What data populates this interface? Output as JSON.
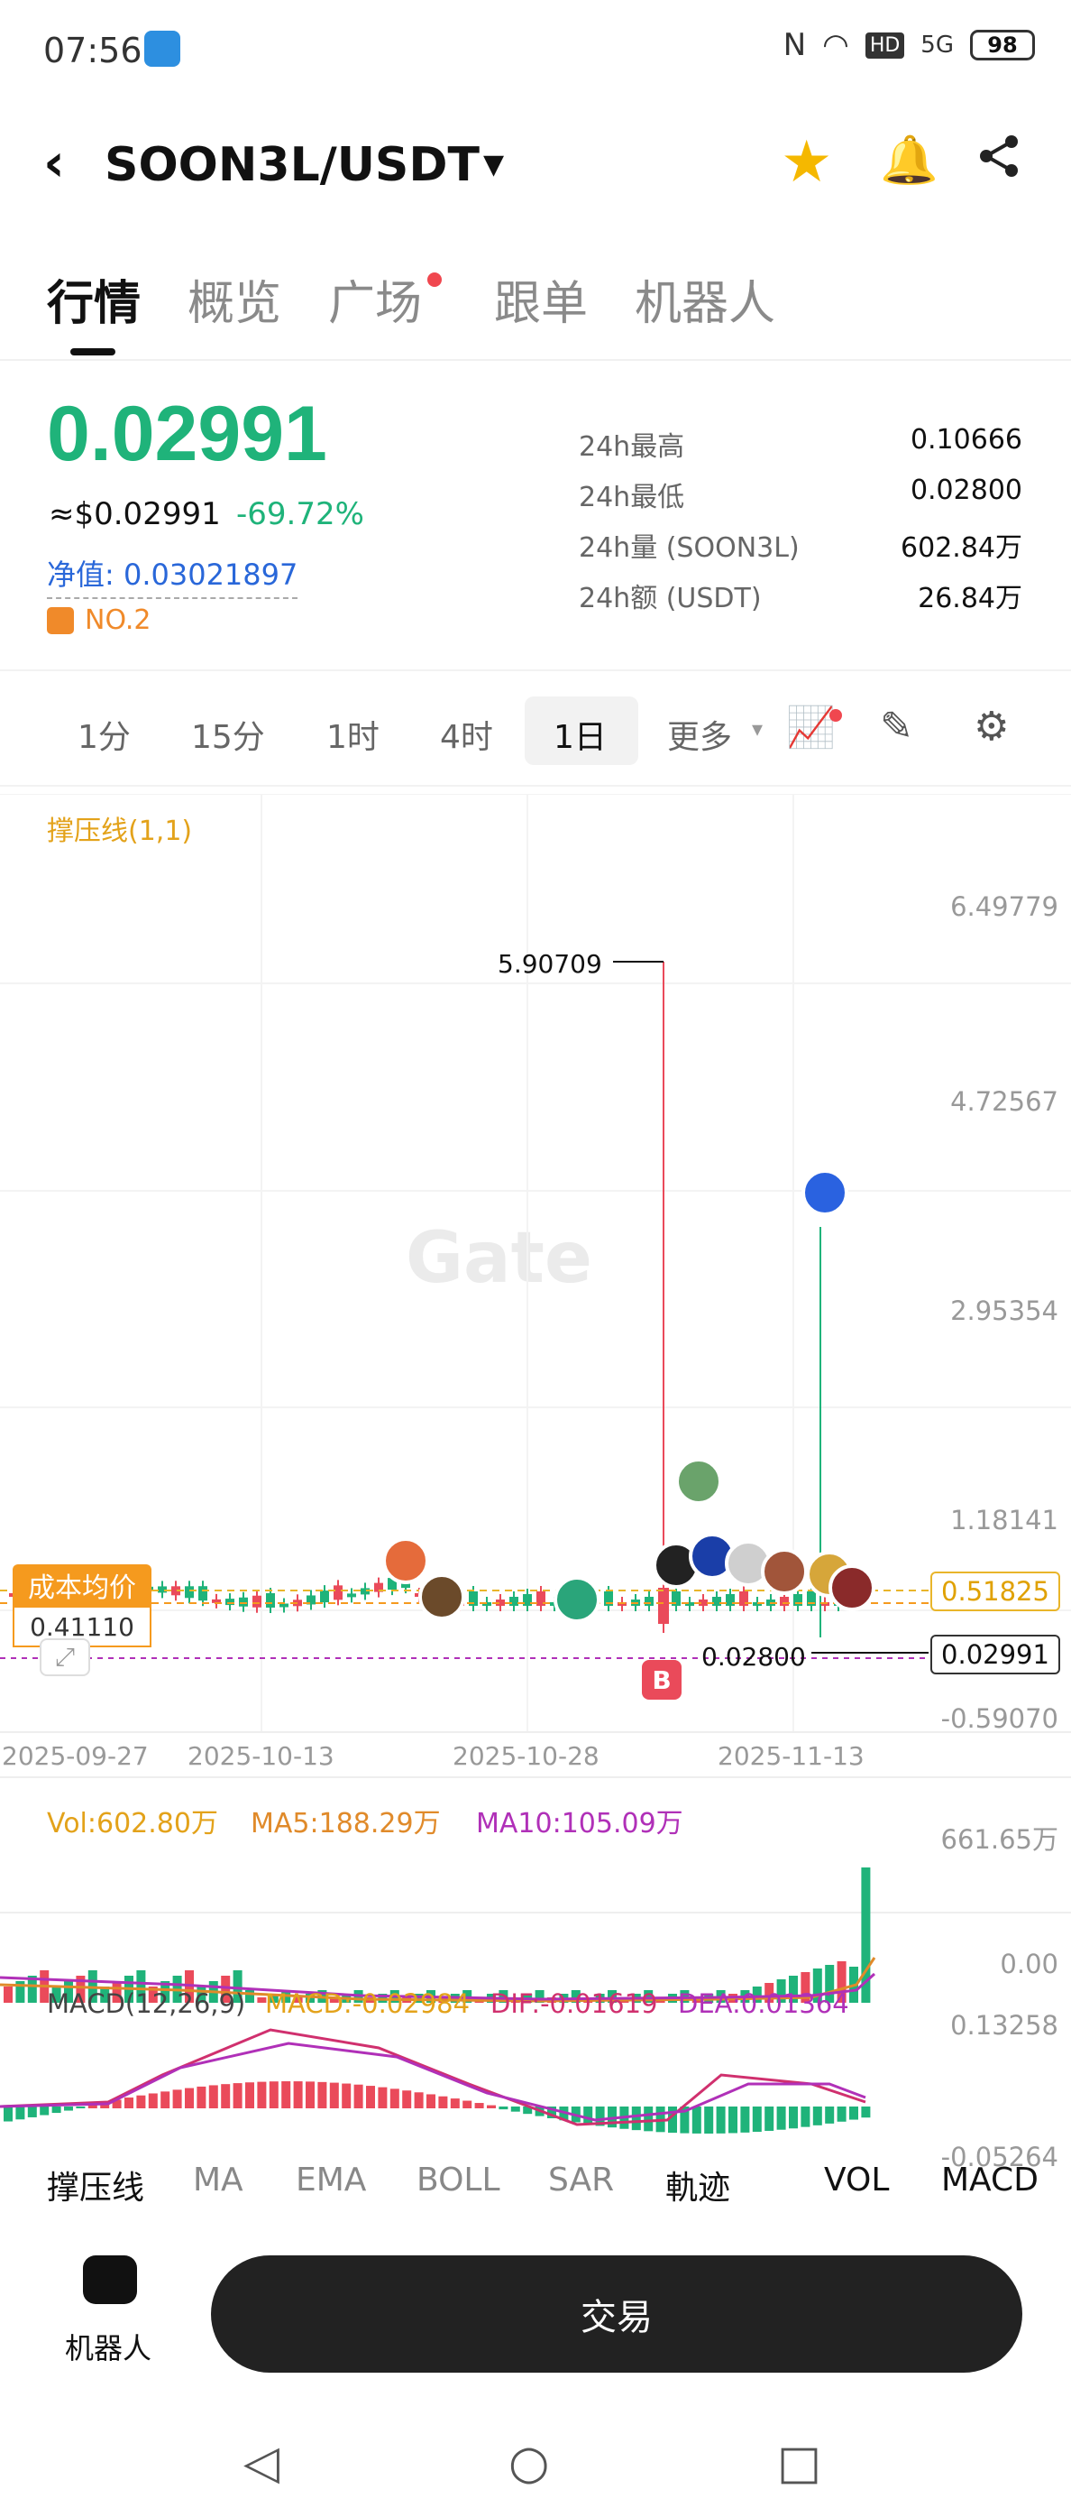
{
  "status_bar": {
    "time": "07:56",
    "battery": "98",
    "net": "5G"
  },
  "header": {
    "pair": "SOON3L/USDT"
  },
  "tabs": [
    {
      "label": "行情",
      "active": true
    },
    {
      "label": "概览"
    },
    {
      "label": "广场",
      "dot": true
    },
    {
      "label": "跟单"
    },
    {
      "label": "机器人"
    }
  ],
  "price": {
    "last": "0.02991",
    "usd": "≈$0.02991",
    "change": "-69.72%",
    "nav": "净值: 0.03021897",
    "rank": "NO.2",
    "color_up": "#1fb37a"
  },
  "stats": [
    {
      "label": "24h最高",
      "value": "0.10666"
    },
    {
      "label": "24h最低",
      "value": "0.02800"
    },
    {
      "label": "24h量 (SOON3L)",
      "value": "602.84万"
    },
    {
      "label": "24h额 (USDT)",
      "value": "26.84万"
    }
  ],
  "timeframes": [
    "1分",
    "15分",
    "1时",
    "4时",
    "1日",
    "更多"
  ],
  "timeframe_active": "1日",
  "chart": {
    "indicator": "撑压线(1,1)",
    "watermark": "Gate",
    "y_labels": [
      "6.49779",
      "4.72567",
      "2.95354",
      "1.18141",
      "-0.59070"
    ],
    "x_labels": [
      "2025-09-27",
      "2025-10-13",
      "2025-10-28",
      "2025-11-13"
    ],
    "high_label": "5.90709",
    "low_label": "0.02800",
    "cost_label": "成本均价",
    "cost_value": "0.41110",
    "support_value": "0.51825",
    "last_value": "0.02991",
    "buy_marker": "B",
    "vol_legend": {
      "vol": "Vol:602.80万",
      "ma5": "MA5:188.29万",
      "ma10": "MA10:105.09万"
    },
    "vol_axis": [
      "661.65万",
      "0.00"
    ],
    "macd_legend": {
      "name": "MACD(12,26,9)",
      "macd": "MACD:-0.02984",
      "dif": "DIF:-0.01619",
      "dea": "DEA:0.01364"
    },
    "macd_axis": [
      "0.13258",
      "-0.05264"
    ]
  },
  "indicator_tabs": [
    "撑压线",
    "MA",
    "EMA",
    "BOLL",
    "SAR",
    "軌迹",
    "VOL",
    "MACD"
  ],
  "footer": {
    "robot_label": "机器人",
    "trade_label": "交易"
  }
}
